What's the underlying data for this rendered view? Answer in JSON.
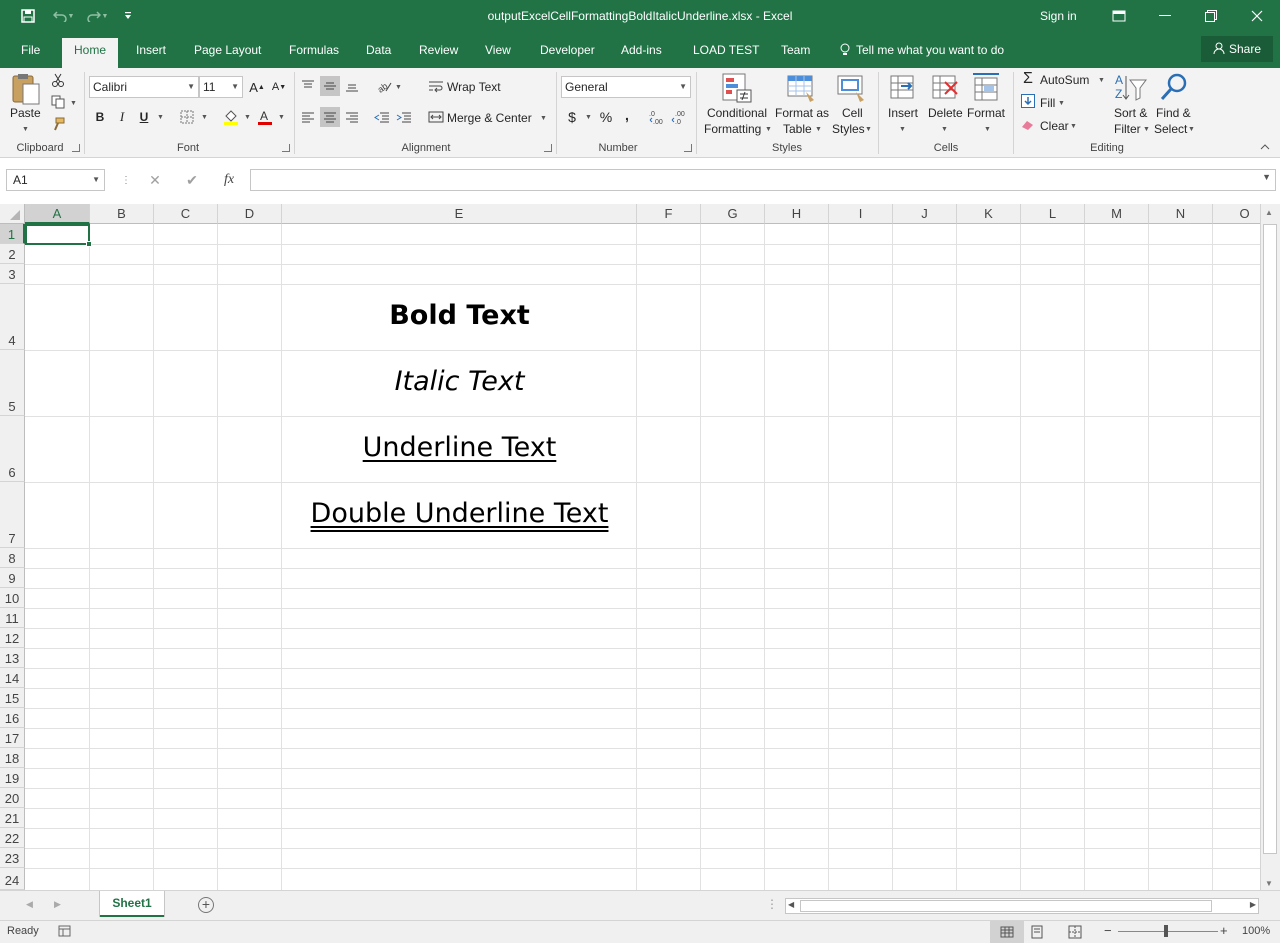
{
  "window": {
    "title": "outputExcelCellFormattingBoldItalicUnderline.xlsx - Excel",
    "sign_in": "Sign in"
  },
  "tabs": [
    {
      "label": "File"
    },
    {
      "label": "Home"
    },
    {
      "label": "Insert"
    },
    {
      "label": "Page Layout"
    },
    {
      "label": "Formulas"
    },
    {
      "label": "Data"
    },
    {
      "label": "Review"
    },
    {
      "label": "View"
    },
    {
      "label": "Developer"
    },
    {
      "label": "Add-ins"
    },
    {
      "label": "LOAD TEST"
    },
    {
      "label": "Team"
    }
  ],
  "tell_me": "Tell me what you want to do",
  "share": "Share",
  "ribbon": {
    "clipboard": {
      "paste": "Paste",
      "label": "Clipboard"
    },
    "font": {
      "name": "Calibri",
      "size": "11",
      "label": "Font",
      "bold": "B",
      "italic": "I",
      "underline": "U"
    },
    "alignment": {
      "wrap": "Wrap Text",
      "merge": "Merge & Center",
      "label": "Alignment"
    },
    "number": {
      "format": "General",
      "label": "Number",
      "currency": "$",
      "percent": "%",
      "comma": ","
    },
    "styles": {
      "conditional_1": "Conditional",
      "conditional_2": "Formatting",
      "table_1": "Format as",
      "table_2": "Table",
      "cell_1": "Cell",
      "cell_2": "Styles",
      "label": "Styles"
    },
    "cells": {
      "insert": "Insert",
      "delete": "Delete",
      "format": "Format",
      "label": "Cells"
    },
    "editing": {
      "autosum": "AutoSum",
      "fill": "Fill",
      "clear": "Clear",
      "sort_1": "Sort &",
      "sort_2": "Filter",
      "find_1": "Find &",
      "find_2": "Select",
      "label": "Editing"
    }
  },
  "formula_bar": {
    "name_box": "A1",
    "fx": "fx",
    "content": ""
  },
  "grid": {
    "columns": [
      "A",
      "B",
      "C",
      "D",
      "E",
      "F",
      "G",
      "H",
      "I",
      "J",
      "K",
      "L",
      "M",
      "N",
      "O"
    ],
    "rows": [
      "1",
      "2",
      "3",
      "4",
      "5",
      "6",
      "7",
      "8",
      "9",
      "10",
      "11",
      "12",
      "13",
      "14",
      "15",
      "16",
      "17",
      "18",
      "19",
      "20",
      "21",
      "22",
      "23",
      "24"
    ],
    "selected_cell": "A1",
    "cells": {
      "E4": "Bold Text",
      "E5": "Italic Text",
      "E6": "Underline Text",
      "E7": "Double Underline Text"
    }
  },
  "sheets": [
    {
      "label": "Sheet1"
    }
  ],
  "status": {
    "ready": "Ready",
    "zoom": "100%"
  },
  "colors": {
    "accent": "#217346",
    "ribbon_bg": "#f3f3f3"
  }
}
